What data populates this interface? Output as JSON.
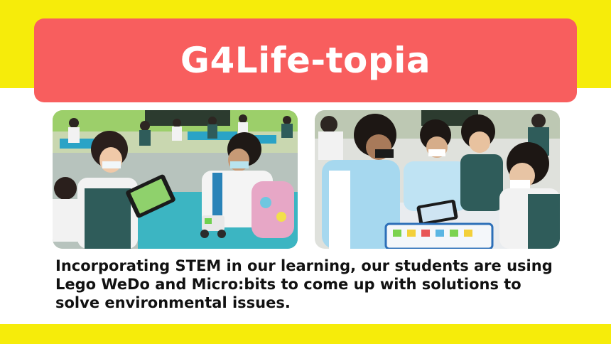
{
  "title": "G4Life-topia",
  "caption": "Incorporating STEM in our learning, our students are using Lego WeDo and Micro:bits to come up with solutions to solve environmental issues.",
  "colors": {
    "accent_yellow": "#f6ec0a",
    "banner_red": "#f85e5e",
    "text_dark": "#111111"
  },
  "images": {
    "left": "classroom-students-lego-wedo-photo",
    "right": "students-microbit-building-photo"
  }
}
